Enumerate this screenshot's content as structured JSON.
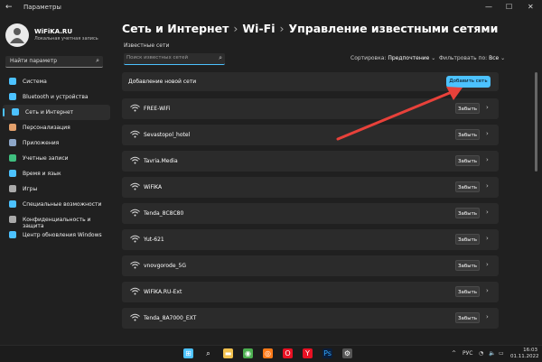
{
  "window": {
    "title": "Параметры",
    "back": "←",
    "min": "—",
    "max": "☐",
    "close": "✕"
  },
  "user": {
    "name": "WiFiKA.RU",
    "subtitle": "Локальная учетная запись"
  },
  "sidebar": {
    "search_placeholder": "Найти параметр",
    "items": [
      {
        "label": "Система",
        "icon": "monitor-icon",
        "color": "#4cc2ff"
      },
      {
        "label": "Bluetooth и устройства",
        "icon": "bluetooth-icon",
        "color": "#4cc2ff"
      },
      {
        "label": "Сеть и Интернет",
        "icon": "network-icon",
        "color": "#4cc2ff"
      },
      {
        "label": "Персонализация",
        "icon": "brush-icon",
        "color": "#e3a06b"
      },
      {
        "label": "Приложения",
        "icon": "apps-icon",
        "color": "#8da6c8"
      },
      {
        "label": "Учетные записи",
        "icon": "account-icon",
        "color": "#3fbf7f"
      },
      {
        "label": "Время и язык",
        "icon": "clock-icon",
        "color": "#4cc2ff"
      },
      {
        "label": "Игры",
        "icon": "gamepad-icon",
        "color": "#aaaaaa"
      },
      {
        "label": "Специальные возможности",
        "icon": "accessibility-icon",
        "color": "#4cc2ff"
      },
      {
        "label": "Конфиденциальность и защита",
        "icon": "shield-icon",
        "color": "#aaaaaa"
      },
      {
        "label": "Центр обновления Windows",
        "icon": "update-icon",
        "color": "#4cc2ff"
      }
    ],
    "active_index": 2
  },
  "breadcrumb": {
    "part1": "Сеть и Интернет",
    "sep": "›",
    "part2": "Wi-Fi",
    "part3": "Управление известными сетями"
  },
  "known": {
    "section_label": "Известные сети",
    "search_placeholder": "Поиск известных сетей",
    "sort_label": "Сортировка:",
    "sort_value": "Предпочтение",
    "filter_label": "Фильтровать по:",
    "filter_value": "Все",
    "add_label": "Добавление новой сети",
    "add_button": "Добавить сеть",
    "forget_label": "Забыть",
    "networks": [
      "FREE-WiFi",
      "Sevastopol_hotel",
      "Tavria.Media",
      "WiFiKA",
      "Tenda_8C8C80",
      "Yut-621",
      "vnovgorode_5G",
      "WiFiKA.RU-Ext",
      "Tenda_8A7000_EXT"
    ]
  },
  "taskbar": {
    "icons": [
      "windows-icon",
      "search-icon",
      "file-explorer-icon",
      "chrome-icon",
      "firefox-icon",
      "opera-icon",
      "yandex-browser-icon",
      "photoshop-icon",
      "settings-icon"
    ],
    "tray_chevron": "^",
    "lang": "РУС",
    "time": "16:03",
    "date": "01.11.2022"
  }
}
